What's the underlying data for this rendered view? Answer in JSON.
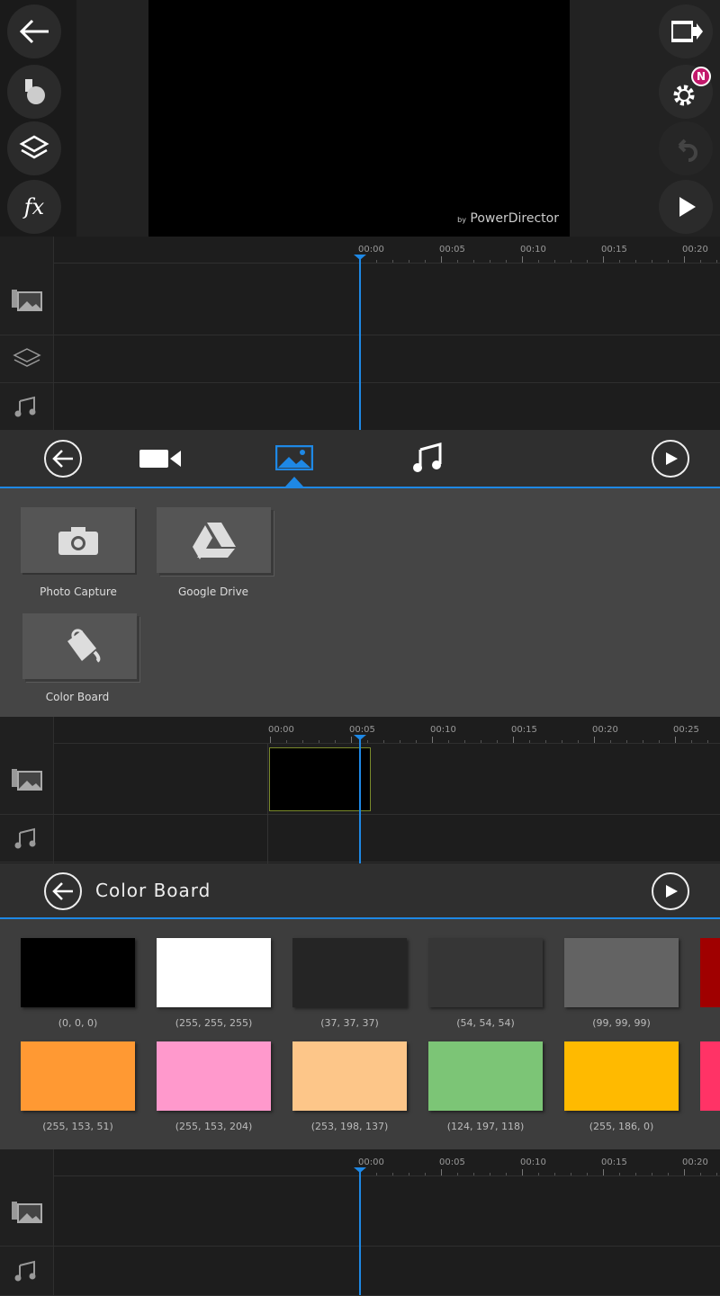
{
  "preview": {
    "watermark_by": "by",
    "watermark": "PowerDirector",
    "badge": "N"
  },
  "left_tools": [
    {
      "icon": "back-arrow-icon"
    },
    {
      "icon": "media-library-icon"
    },
    {
      "icon": "layers-icon"
    },
    {
      "icon": "fx-icon",
      "label": "fx"
    }
  ],
  "right_tools": [
    {
      "icon": "export-video-icon"
    },
    {
      "icon": "settings-icon"
    },
    {
      "icon": "undo-icon"
    },
    {
      "icon": "play-icon"
    }
  ],
  "ruler_a": [
    "00:00",
    "00:05",
    "00:10",
    "00:15",
    "00:20"
  ],
  "ruler_b": [
    "00:00",
    "00:05",
    "00:10",
    "00:15",
    "00:20",
    "00:25"
  ],
  "media_tabs": [
    {
      "icon": "video-icon"
    },
    {
      "icon": "image-icon",
      "active": true
    },
    {
      "icon": "music-icon"
    }
  ],
  "media_tiles": [
    {
      "label": "Photo Capture",
      "icon": "camera-icon"
    },
    {
      "label": "Google Drive",
      "icon": "google-drive-icon"
    },
    {
      "label": "Color Board",
      "icon": "paint-bucket-icon"
    }
  ],
  "color_board": {
    "title": "Color Board",
    "row1": [
      {
        "color": "#000000",
        "label": "(0, 0, 0)"
      },
      {
        "color": "#ffffff",
        "label": "(255, 255, 255)"
      },
      {
        "color": "#252525",
        "label": "(37, 37, 37)"
      },
      {
        "color": "#363636",
        "label": "(54, 54, 54)"
      },
      {
        "color": "#636363",
        "label": "(99, 99, 99)"
      },
      {
        "color": "#a00000"
      }
    ],
    "row2": [
      {
        "color": "#ff9933",
        "label": "(255, 153, 51)"
      },
      {
        "color": "#ff99cc",
        "label": "(255, 153, 204)"
      },
      {
        "color": "#fdc689",
        "label": "(253, 198, 137)"
      },
      {
        "color": "#7cc576",
        "label": "(124, 197, 118)"
      },
      {
        "color": "#ffba00",
        "label": "(255, 186, 0)"
      },
      {
        "color": "#ff3366"
      }
    ]
  },
  "accent": "#1e88e5"
}
